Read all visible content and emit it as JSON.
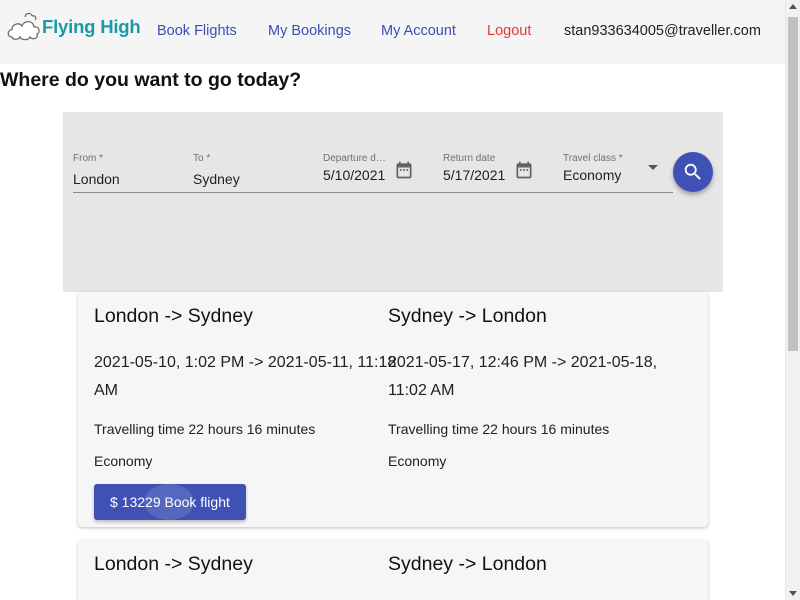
{
  "header": {
    "logo_text": "Flying High",
    "nav": {
      "book_flights": "Book Flights",
      "my_bookings": "My Bookings",
      "my_account": "My Account",
      "logout": "Logout"
    },
    "user_email": "stan933634005@traveller.com"
  },
  "page_title": "Where do you want to go today?",
  "search": {
    "from_label": "From *",
    "from_value": "London",
    "to_label": "To *",
    "to_value": "Sydney",
    "departure_label": "Departure date",
    "departure_value": "5/10/2021",
    "return_label": "Return date",
    "return_value": "5/17/2021",
    "class_label": "Travel class *",
    "class_value": "Economy"
  },
  "results": [
    {
      "outbound": {
        "route": "London -> Sydney",
        "times": "2021-05-10, 1:02 PM -> 2021-05-11, 11:18 AM",
        "travel_time": "Travelling time 22 hours 16 minutes",
        "cabin": "Economy"
      },
      "return": {
        "route": "Sydney -> London",
        "times": "2021-05-17, 12:46 PM -> 2021-05-18, 11:02 AM",
        "travel_time": "Travelling time 22 hours 16 minutes",
        "cabin": "Economy"
      },
      "book_label": "$ 13229 Book flight"
    },
    {
      "outbound": {
        "route": "London -> Sydney"
      },
      "return": {
        "route": "Sydney -> London"
      }
    }
  ],
  "colors": {
    "primary": "#3f51b5",
    "logout": "#e53935",
    "logo": "#1a9aa6",
    "panel": "#e6e6e6"
  },
  "icons": [
    "cloud-logo-icon",
    "calendar-icon",
    "dropdown-arrow-icon",
    "search-icon"
  ]
}
